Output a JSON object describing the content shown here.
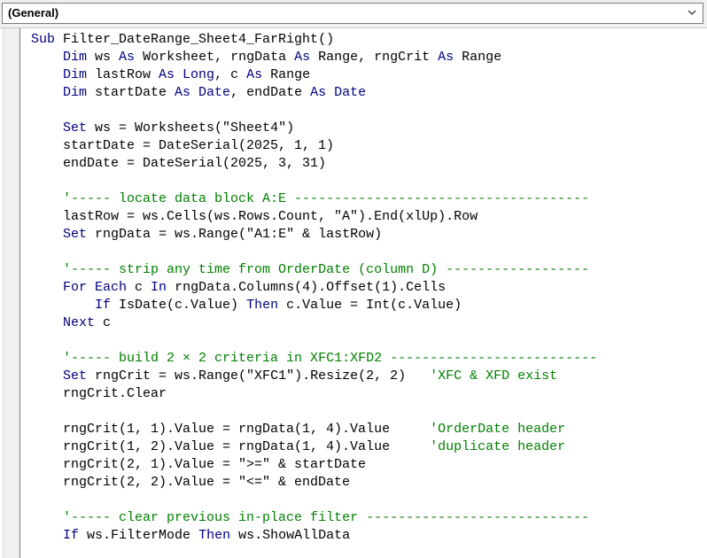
{
  "procedure_dropdown": {
    "value": "(General)"
  },
  "code_lines": [
    [
      [
        "kw",
        "Sub "
      ],
      [
        "tx",
        "Filter_DateRange_Sheet4_FarRight()"
      ]
    ],
    [
      [
        "tx",
        "    "
      ],
      [
        "kw",
        "Dim "
      ],
      [
        "tx",
        "ws "
      ],
      [
        "kw",
        "As "
      ],
      [
        "tx",
        "Worksheet, rngData "
      ],
      [
        "kw",
        "As "
      ],
      [
        "tx",
        "Range, rngCrit "
      ],
      [
        "kw",
        "As "
      ],
      [
        "tx",
        "Range"
      ]
    ],
    [
      [
        "tx",
        "    "
      ],
      [
        "kw",
        "Dim "
      ],
      [
        "tx",
        "lastRow "
      ],
      [
        "kw",
        "As Long"
      ],
      [
        "tx",
        ", c "
      ],
      [
        "kw",
        "As "
      ],
      [
        "tx",
        "Range"
      ]
    ],
    [
      [
        "tx",
        "    "
      ],
      [
        "kw",
        "Dim "
      ],
      [
        "tx",
        "startDate "
      ],
      [
        "kw",
        "As Date"
      ],
      [
        "tx",
        ", endDate "
      ],
      [
        "kw",
        "As Date"
      ]
    ],
    [],
    [
      [
        "tx",
        "    "
      ],
      [
        "kw",
        "Set "
      ],
      [
        "tx",
        "ws = Worksheets(\"Sheet4\")"
      ]
    ],
    [
      [
        "tx",
        "    startDate = DateSerial(2025, 1, 1)"
      ]
    ],
    [
      [
        "tx",
        "    endDate = DateSerial(2025, 3, 31)"
      ]
    ],
    [],
    [
      [
        "tx",
        "    "
      ],
      [
        "cm",
        "'----- locate data block A:E -------------------------------------"
      ]
    ],
    [
      [
        "tx",
        "    lastRow = ws.Cells(ws.Rows.Count, \"A\").End(xlUp).Row"
      ]
    ],
    [
      [
        "tx",
        "    "
      ],
      [
        "kw",
        "Set "
      ],
      [
        "tx",
        "rngData = ws.Range(\"A1:E\" & lastRow)"
      ]
    ],
    [],
    [
      [
        "tx",
        "    "
      ],
      [
        "cm",
        "'----- strip any time from OrderDate (column D) ------------------"
      ]
    ],
    [
      [
        "tx",
        "    "
      ],
      [
        "kw",
        "For Each "
      ],
      [
        "tx",
        "c "
      ],
      [
        "kw",
        "In "
      ],
      [
        "tx",
        "rngData.Columns(4).Offset(1).Cells"
      ]
    ],
    [
      [
        "tx",
        "        "
      ],
      [
        "kw",
        "If "
      ],
      [
        "tx",
        "IsDate(c.Value) "
      ],
      [
        "kw",
        "Then "
      ],
      [
        "tx",
        "c.Value = Int(c.Value)"
      ]
    ],
    [
      [
        "tx",
        "    "
      ],
      [
        "kw",
        "Next "
      ],
      [
        "tx",
        "c"
      ]
    ],
    [],
    [
      [
        "tx",
        "    "
      ],
      [
        "cm",
        "'----- build 2 × 2 criteria in XFC1:XFD2 --------------------------"
      ]
    ],
    [
      [
        "tx",
        "    "
      ],
      [
        "kw",
        "Set "
      ],
      [
        "tx",
        "rngCrit = ws.Range(\"XFC1\").Resize(2, 2)   "
      ],
      [
        "cm",
        "'XFC & XFD exist"
      ]
    ],
    [
      [
        "tx",
        "    rngCrit.Clear"
      ]
    ],
    [],
    [
      [
        "tx",
        "    rngCrit(1, 1).Value = rngData(1, 4).Value     "
      ],
      [
        "cm",
        "'OrderDate header"
      ]
    ],
    [
      [
        "tx",
        "    rngCrit(1, 2).Value = rngData(1, 4).Value     "
      ],
      [
        "cm",
        "'duplicate header"
      ]
    ],
    [
      [
        "tx",
        "    rngCrit(2, 1).Value = \">=\" & startDate"
      ]
    ],
    [
      [
        "tx",
        "    rngCrit(2, 2).Value = \"<=\" & endDate"
      ]
    ],
    [],
    [
      [
        "tx",
        "    "
      ],
      [
        "cm",
        "'----- clear previous in-place filter ----------------------------"
      ]
    ],
    [
      [
        "tx",
        "    "
      ],
      [
        "kw",
        "If "
      ],
      [
        "tx",
        "ws.FilterMode "
      ],
      [
        "kw",
        "Then "
      ],
      [
        "tx",
        "ws.ShowAllData"
      ]
    ]
  ],
  "colors": {
    "keyword": "#00007f",
    "comment": "#008000",
    "text": "#000000"
  },
  "icons": {
    "dropdown_arrow": "chevron-down-icon"
  }
}
